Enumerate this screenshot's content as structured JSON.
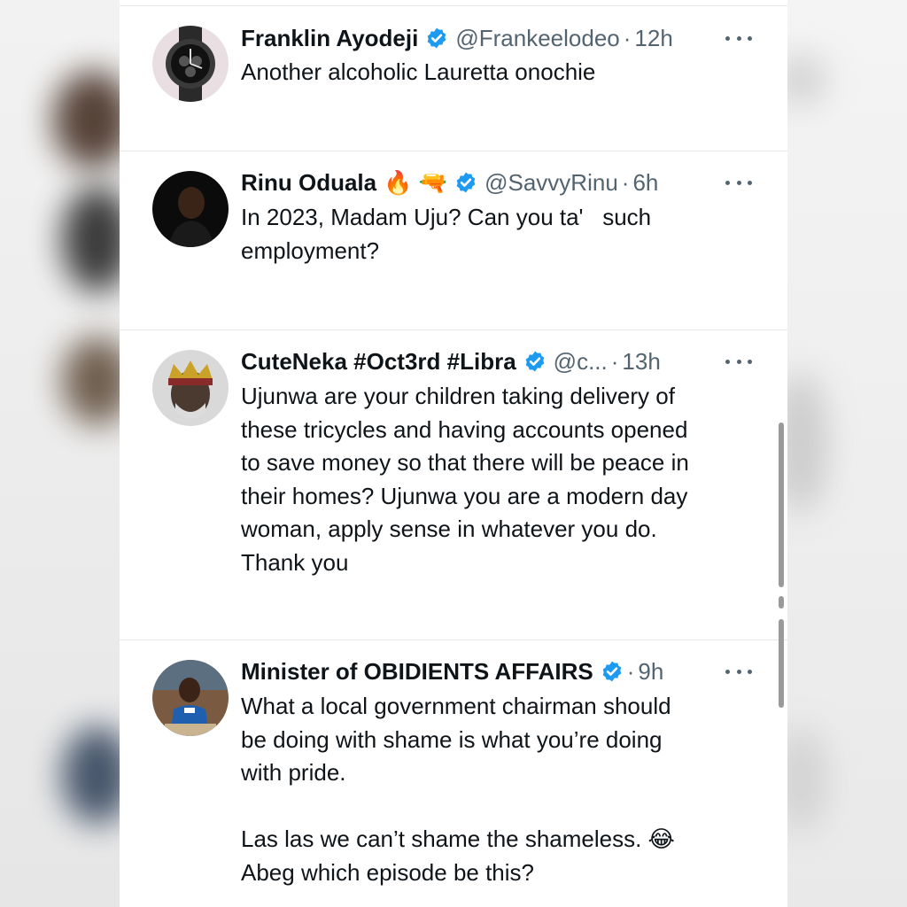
{
  "colors": {
    "text": "#0f1419",
    "muted": "#536471",
    "verified": "#1d9bf0",
    "divider": "#e6e9ea"
  },
  "tweets": [
    {
      "name": "Franklin Ayodeji",
      "handle": "@Frankeelodeo",
      "separator": "·",
      "time": "12h",
      "text": "Another alcoholic Lauretta onochie",
      "avatar_icon": "wristwatch-icon"
    },
    {
      "name": "Rinu Oduala",
      "name_emojis": "🔥 🔫",
      "handle": "@SavvyRinu",
      "separator": "·",
      "time": "6h",
      "text": "In 2023, Madam Uju? Can you ta'   such\nemployment?",
      "avatar_icon": "portrait-icon"
    },
    {
      "name": "CuteNeka #Oct3rd #Libra",
      "handle": "@c...",
      "separator": "·",
      "time": "13h",
      "text": "Ujunwa are your children taking delivery of\nthese tricycles and having accounts opened\nto save money so that there will be peace in\ntheir homes? Ujunwa you are a modern day\nwoman, apply sense in whatever you do.\nThank you",
      "avatar_icon": "crowned-man-icon"
    },
    {
      "name": "Minister of OBIDIENTS AFFAIRS",
      "handle": "",
      "separator": "·",
      "time": "9h",
      "text": "What a local government chairman should\nbe doing with shame is what you’re doing\nwith pride.\n\nLas las we can’t shame the shameless. 😂\nAbeg which episode be this?",
      "avatar_icon": "child-photo-icon"
    }
  ]
}
